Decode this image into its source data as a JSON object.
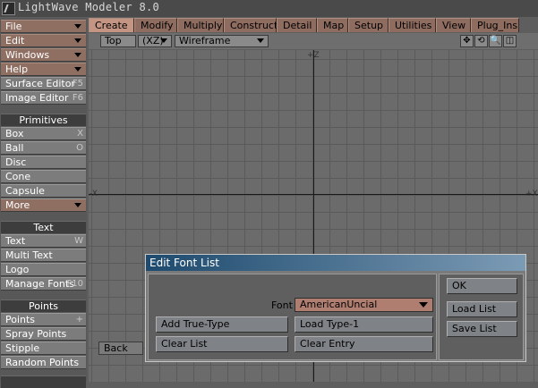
{
  "window": {
    "title": "LightWave Modeler 8.0"
  },
  "sidebar": {
    "menus": [
      "File",
      "Edit",
      "Windows",
      "Help"
    ],
    "editors": [
      {
        "label": "Surface Editor",
        "key": "F5"
      },
      {
        "label": "Image Editor",
        "key": "F6"
      }
    ],
    "primitives_header": "Primitives",
    "primitives": [
      {
        "label": "Box",
        "key": "X"
      },
      {
        "label": "Ball",
        "key": "O"
      },
      {
        "label": "Disc",
        "key": ""
      },
      {
        "label": "Cone",
        "key": ""
      },
      {
        "label": "Capsule",
        "key": ""
      },
      {
        "label": "More",
        "key": ""
      }
    ],
    "text_header": "Text",
    "text_items": [
      {
        "label": "Text",
        "key": "W"
      },
      {
        "label": "Multi Text",
        "key": ""
      },
      {
        "label": "Logo",
        "key": ""
      },
      {
        "label": "Manage Fonts",
        "key": "F10"
      }
    ],
    "points_header": "Points",
    "points_items": [
      {
        "label": "Points",
        "key": "+"
      },
      {
        "label": "Spray Points",
        "key": ""
      },
      {
        "label": "Stipple",
        "key": ""
      },
      {
        "label": "Random Points",
        "key": ""
      }
    ]
  },
  "tabs": [
    "Create",
    "Modify",
    "Multiply",
    "Construct",
    "Detail",
    "Map",
    "Setup",
    "Utilities",
    "View",
    "Plug_Ins"
  ],
  "viewport": {
    "view": "Top",
    "axes": "(XZ)",
    "shading": "Wireframe",
    "top_label": "+Z",
    "left_label": "-X",
    "right_label": "+X",
    "back_label": "Back"
  },
  "dialog": {
    "title": "Edit Font List",
    "font_label": "Font",
    "font_value": "AmericanUncial",
    "add_truetype": "Add True-Type",
    "load_type1": "Load Type-1",
    "clear_list": "Clear List",
    "clear_entry": "Clear Entry",
    "ok": "OK",
    "load_list": "Load List",
    "save_list": "Save List"
  }
}
